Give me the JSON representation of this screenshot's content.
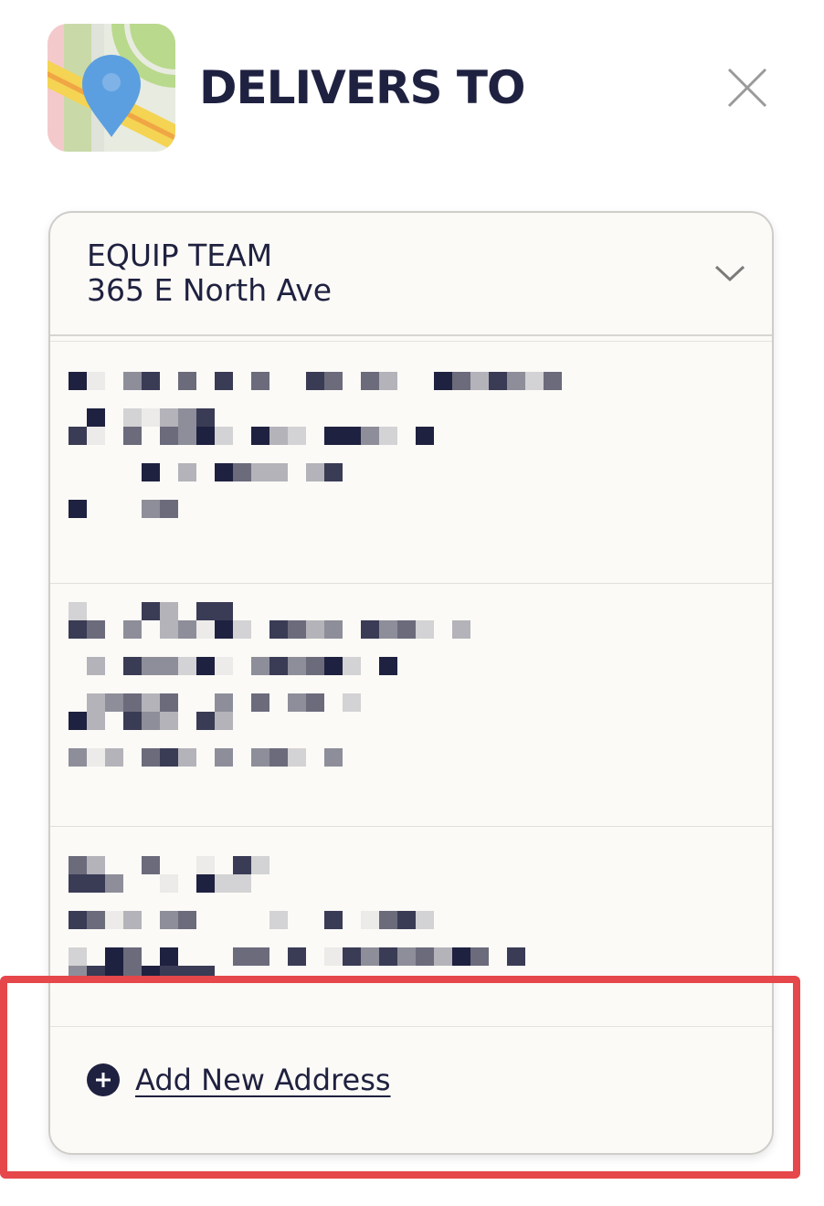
{
  "header": {
    "title": "DELIVERS TO",
    "icon": "map-pin-icon",
    "close_icon": "close-icon"
  },
  "selected_address": {
    "name": "EQUIP TEAM",
    "street": "365 E North Ave",
    "icon": "chevron-down-icon"
  },
  "address_list": {
    "items_count_visible": 3,
    "note": ""
  },
  "footer": {
    "add_label": "Add New Address",
    "add_icon": "plus-circle-icon"
  },
  "colors": {
    "text": "#1f2140",
    "panel_bg": "#fcfaf6",
    "highlight": "#e5474a",
    "map_pin": "#5b9fe0"
  }
}
